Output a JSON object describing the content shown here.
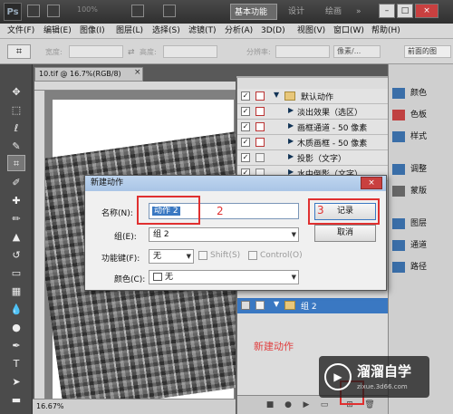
{
  "titlebar": {
    "app_logo": "Ps",
    "zoom": "100%",
    "workspaces": [
      "基本功能",
      "设计",
      "绘画",
      "»"
    ],
    "window_buttons": [
      "–",
      "□",
      "×"
    ]
  },
  "menubar": {
    "items": [
      "文件(F)",
      "编辑(E)",
      "图像(I)",
      "图层(L)",
      "选择(S)",
      "滤镜(T)",
      "分析(A)",
      "3D(D)",
      "视图(V)",
      "窗口(W)",
      "帮助(H)"
    ]
  },
  "options_bar": {
    "width_label": "宽度:",
    "height_label": "高度:",
    "resolution_label": "分辨率:",
    "unit": "像素/...",
    "front_image_button": "前面的图"
  },
  "document": {
    "tab_title": "10.tif @ 16.7%(RGB/8)",
    "status_zoom": "16.67%"
  },
  "actions_panel": {
    "tab_label": "动作",
    "rows": [
      {
        "label": "默认动作",
        "kind": "set",
        "checked": true,
        "dialog": "red"
      },
      {
        "label": "淡出效果（选区）",
        "kind": "action",
        "checked": true,
        "dialog": "red"
      },
      {
        "label": "画框通道 - 50 像素",
        "kind": "action",
        "checked": true,
        "dialog": "red"
      },
      {
        "label": "木质画框 - 50 像素",
        "kind": "action",
        "checked": true,
        "dialog": "red"
      },
      {
        "label": "投影（文字）",
        "kind": "action",
        "checked": true,
        "dialog": "plain"
      },
      {
        "label": "水中倒影（文字）",
        "kind": "action",
        "checked": true,
        "dialog": "plain"
      }
    ],
    "group2_label": "组 2",
    "note": "新建动作"
  },
  "right_dock": {
    "items": [
      "颜色",
      "色板",
      "样式",
      "调整",
      "蒙版",
      "图层",
      "通道",
      "路径"
    ],
    "icon_colors": [
      "#3a6ea8",
      "#c04040",
      "#3a6ea8",
      "#3a6ea8",
      "#666666",
      "#3a6ea8",
      "#3a6ea8",
      "#3a6ea8"
    ]
  },
  "dialog": {
    "title": "新建动作",
    "close": "×",
    "name_label": "名称(N):",
    "name_value": "动作 2",
    "group_label": "组(E):",
    "group_value": "组 2",
    "fkey_label": "功能键(F):",
    "fkey_value": "无",
    "shift_label": "Shift(S)",
    "control_label": "Control(O)",
    "color_label": "颜色(C):",
    "color_value": "无",
    "record_button": "记录",
    "cancel_button": "取消",
    "annotation_2": "2",
    "annotation_3": "3"
  },
  "watermark": {
    "logo": "▶",
    "name": "溜溜自学",
    "url": "zixue.3d66.com"
  },
  "colors": {
    "highlight": "#e03030",
    "selection": "#3a78c2"
  }
}
